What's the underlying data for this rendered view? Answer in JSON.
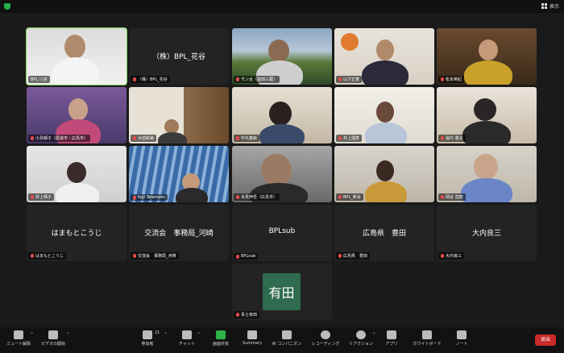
{
  "topbar": {
    "view_label": "表示"
  },
  "tiles": [
    {
      "label": "BPL 川本",
      "name": ""
    },
    {
      "label": "（株）BPL_花谷",
      "name": "（株）BPL_花谷"
    },
    {
      "label": "モン太（益田三蔵）",
      "name": ""
    },
    {
      "label": "山下正寛",
      "name": ""
    },
    {
      "label": "松本英紀",
      "name": ""
    },
    {
      "label": "小島郁子（尾道市・広島市）",
      "name": ""
    },
    {
      "label": "大前和美",
      "name": ""
    },
    {
      "label": "中丸春絵",
      "name": ""
    },
    {
      "label": "井上理恵",
      "name": ""
    },
    {
      "label": "堀内 重夫",
      "name": ""
    },
    {
      "label": "井上晴子",
      "name": ""
    },
    {
      "label": "Koji Teramoto",
      "name": ""
    },
    {
      "label": "永見伸吾（広島市）",
      "name": ""
    },
    {
      "label": "BPL_新谷",
      "name": ""
    },
    {
      "label": "岡谷 直樹",
      "name": ""
    },
    {
      "label": "はまもとこうじ",
      "name": "はまもとこうじ"
    },
    {
      "label": "交流会　事務局_河崎",
      "name": "交流会　事務局_河崎"
    },
    {
      "label": "BPLsub",
      "name": "BPLsub"
    },
    {
      "label": "広島県　豊田",
      "name": "広島県　豊田"
    },
    {
      "label": "大内良三",
      "name": "大内良三"
    },
    {
      "label": "青士有田",
      "name": ""
    }
  ],
  "avatar_text": "有田",
  "toolbar": {
    "mute": "ミュート解除",
    "video": "ビデオの開始",
    "participants": "参加者",
    "participants_count": "21",
    "chat": "チャット",
    "share": "画面共有",
    "summary": "Summary",
    "ai": "AI コンパニオン",
    "record": "レコーディング",
    "reactions": "リアクション",
    "apps": "アプリ",
    "whiteboard": "ホワイトボード",
    "notes": "ノート",
    "leave": "退出"
  }
}
